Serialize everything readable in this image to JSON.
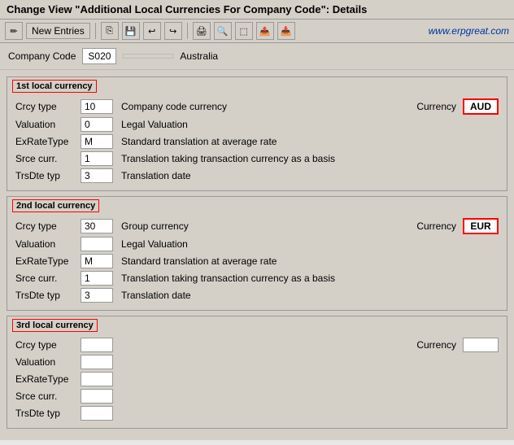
{
  "title": "Change View \"Additional Local Currencies For Company Code\": Details",
  "branding": "www.erpgreat.com",
  "toolbar": {
    "new_entries_label": "New Entries",
    "icons": [
      "✏️",
      "💾",
      "📋",
      "↩",
      "↪",
      "🖨",
      "⬛",
      "⬜",
      "📤",
      "📥"
    ]
  },
  "company": {
    "label": "Company Code",
    "code": "S020",
    "name": "Australia"
  },
  "sections": [
    {
      "id": "1st",
      "title": "1st local currency",
      "fields": [
        {
          "label": "Crcy type",
          "value": "10",
          "description": "Company code currency",
          "has_currency": true,
          "currency": "AUD",
          "currency_bordered": true
        },
        {
          "label": "Valuation",
          "value": "0",
          "description": "Legal Valuation"
        },
        {
          "label": "ExRateType",
          "value": "M",
          "description": "Standard translation at average rate"
        },
        {
          "label": "Srce curr.",
          "value": "1",
          "description": "Translation taking transaction currency as a basis"
        },
        {
          "label": "TrsDte typ",
          "value": "3",
          "description": "Translation date"
        }
      ]
    },
    {
      "id": "2nd",
      "title": "2nd local currency",
      "fields": [
        {
          "label": "Crcy type",
          "value": "30",
          "description": "Group currency",
          "has_currency": true,
          "currency": "EUR",
          "currency_bordered": true
        },
        {
          "label": "Valuation",
          "value": "",
          "description": "Legal Valuation"
        },
        {
          "label": "ExRateType",
          "value": "M",
          "description": "Standard translation at average rate"
        },
        {
          "label": "Srce curr.",
          "value": "1",
          "description": "Translation taking transaction currency as a basis"
        },
        {
          "label": "TrsDte typ",
          "value": "3",
          "description": "Translation date"
        }
      ]
    },
    {
      "id": "3rd",
      "title": "3rd local currency",
      "fields": [
        {
          "label": "Crcy type",
          "value": "",
          "description": "",
          "has_currency": true,
          "currency": "",
          "currency_bordered": false
        },
        {
          "label": "Valuation",
          "value": "",
          "description": ""
        },
        {
          "label": "ExRateType",
          "value": "",
          "description": ""
        },
        {
          "label": "Srce curr.",
          "value": "",
          "description": ""
        },
        {
          "label": "TrsDte typ",
          "value": "",
          "description": ""
        }
      ]
    }
  ]
}
